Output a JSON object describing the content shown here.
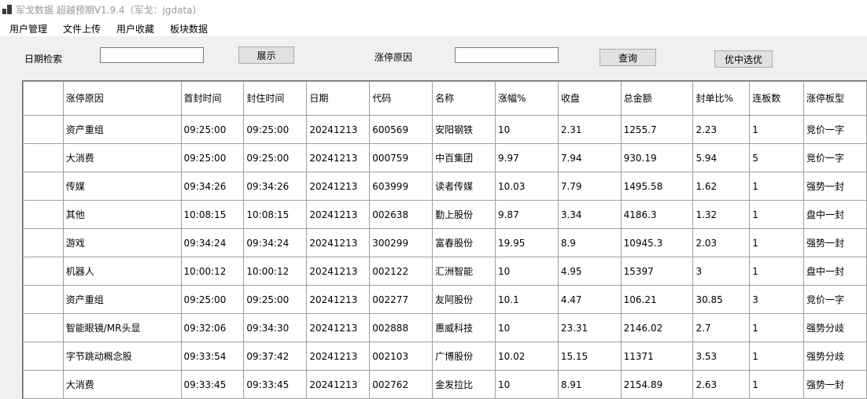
{
  "window": {
    "title": "军戈数据 超越预期V1.9.4（军戈：jgdata)"
  },
  "menu": [
    "用户管理",
    "文件上传",
    "用户收藏",
    "板块数据"
  ],
  "toolbar": {
    "date_label": "日期检索",
    "date_value": "",
    "show_button": "展示",
    "reason_label": "涨停原因",
    "reason_value": "",
    "query_button": "查询",
    "select_button": "优中选优"
  },
  "table": {
    "columns": [
      "涨停原因",
      "首封时间",
      "封住时间",
      "日期",
      "代码",
      "名称",
      "涨幅%",
      "收盘",
      "总金额",
      "封单比%",
      "连板数",
      "涨停板型"
    ],
    "rows": [
      [
        "资产重组",
        "09:25:00",
        "09:25:00",
        "20241213",
        "600569",
        "安阳钢铁",
        "10",
        "2.31",
        "1255.7",
        "2.23",
        "1",
        "竞价一字"
      ],
      [
        "大消费",
        "09:25:00",
        "09:25:00",
        "20241213",
        "000759",
        "中百集团",
        "9.97",
        "7.94",
        "930.19",
        "5.94",
        "5",
        "竞价一字"
      ],
      [
        "传媒",
        "09:34:26",
        "09:34:26",
        "20241213",
        "603999",
        "读者传媒",
        "10.03",
        "7.79",
        "1495.58",
        "1.62",
        "1",
        "强势一封"
      ],
      [
        "其他",
        "10:08:15",
        "10:08:15",
        "20241213",
        "002638",
        "勤上股份",
        "9.87",
        "3.34",
        "4186.3",
        "1.32",
        "1",
        "盘中一封"
      ],
      [
        "游戏",
        "09:34:24",
        "09:34:24",
        "20241213",
        "300299",
        "富春股份",
        "19.95",
        "8.9",
        "10945.3",
        "2.03",
        "1",
        "强势一封"
      ],
      [
        "机器人",
        "10:00:12",
        "10:00:12",
        "20241213",
        "002122",
        "汇洲智能",
        "10",
        "4.95",
        "15397",
        "3",
        "1",
        "盘中一封"
      ],
      [
        "资产重组",
        "09:25:00",
        "09:25:00",
        "20241213",
        "002277",
        "友阿股份",
        "10.1",
        "4.47",
        "106.21",
        "30.85",
        "3",
        "竞价一字"
      ],
      [
        "智能眼镜/MR头显",
        "09:32:06",
        "09:34:30",
        "20241213",
        "002888",
        "惠威科技",
        "10",
        "23.31",
        "2146.02",
        "2.7",
        "1",
        "强势分歧"
      ],
      [
        "字节跳动概念股",
        "09:33:54",
        "09:37:42",
        "20241213",
        "002103",
        "广博股份",
        "10.02",
        "15.15",
        "11371",
        "3.53",
        "1",
        "强势分歧"
      ],
      [
        "大消费",
        "09:33:45",
        "09:33:45",
        "20241213",
        "002762",
        "金发拉比",
        "10",
        "8.91",
        "2154.89",
        "2.63",
        "1",
        "强势一封"
      ]
    ]
  }
}
